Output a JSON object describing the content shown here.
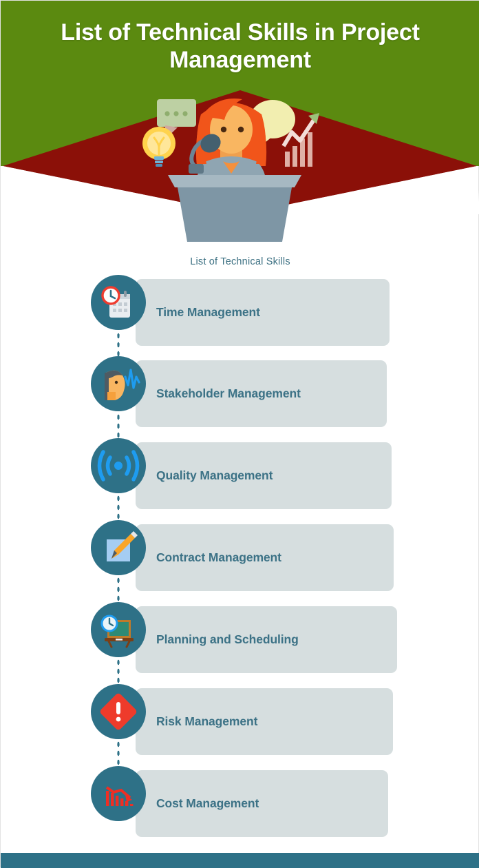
{
  "header": {
    "title": "List of Technical Skills in Project Management",
    "bg_color": "#5b8a10",
    "diamond_color": "#8b1008"
  },
  "illustration": {
    "name": "woman-speaking-at-podium",
    "elements": [
      "lightbulb-icon",
      "chat-bubble-icon",
      "speech-bubble-icon",
      "growth-chart-icon",
      "microphone-icon",
      "podium"
    ],
    "hair_color": "#f1551a",
    "skin_color": "#f9b661",
    "shirt_color": "#8fa5b2",
    "podium_color": "#7e96a5"
  },
  "subtitle": "List of Technical Skills",
  "theme": {
    "accent": "#2e7187",
    "text": "#3c7286",
    "bar": "#d6dedf",
    "footer": "#2e7187",
    "alert_red": "#ee3b2b",
    "signal_blue": "#1e9cf0"
  },
  "skills": [
    {
      "label": "Time Management",
      "icon": "clock-calendar-icon"
    },
    {
      "label": "Stakeholder Management",
      "icon": "speaking-head-icon"
    },
    {
      "label": "Quality Management",
      "icon": "signal-broadcast-icon"
    },
    {
      "label": "Contract Management",
      "icon": "document-pencil-icon"
    },
    {
      "label": "Planning and Scheduling",
      "icon": "blackboard-clock-icon"
    },
    {
      "label": "Risk Management",
      "icon": "warning-diamond-icon"
    },
    {
      "label": "Cost Management",
      "icon": "declining-chart-icon"
    }
  ]
}
